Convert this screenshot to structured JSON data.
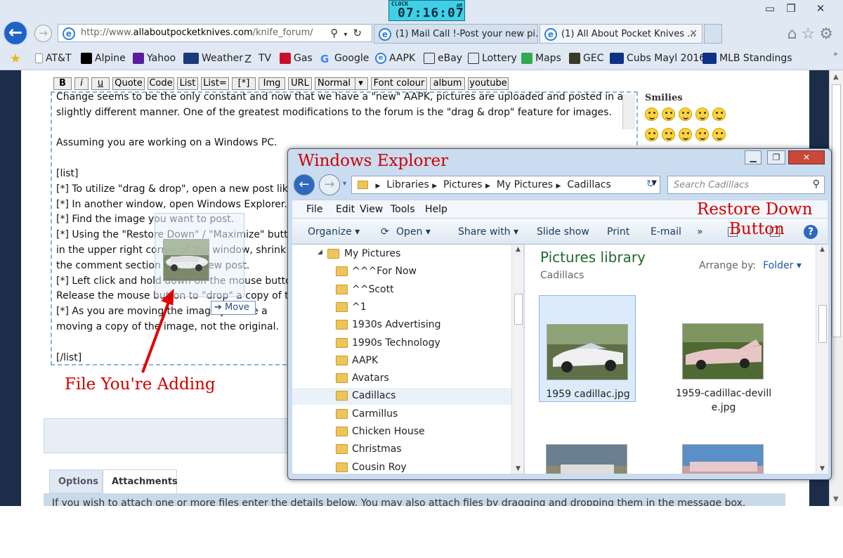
{
  "clock": {
    "label": "CLOCK",
    "time": "07:16:07",
    "ampm": "AM"
  },
  "window_controls": {
    "minimize": "▭",
    "restore": "❐",
    "close": "✕"
  },
  "address": {
    "url_prefix": "http://www.",
    "url_domain": "allaboutpocketknives.com",
    "url_path": "/knife_forum/pos"
  },
  "tabs": [
    {
      "label": "(1) Mail Call !-Post your new pi..."
    },
    {
      "label": "(1) All About Pocket Knives ..."
    }
  ],
  "favorites": [
    {
      "label": "AT&T",
      "color": "#ffffff"
    },
    {
      "label": "Alpine",
      "color": "#000000"
    },
    {
      "label": "Yahoo",
      "color": "#5b1c9c"
    },
    {
      "label": "Weather",
      "color": "#1a3a7a"
    },
    {
      "label": "TV",
      "color": "#ffffff"
    },
    {
      "label": "Gas",
      "color": "#c8102e"
    },
    {
      "label": "Google",
      "color": "#ffffff"
    },
    {
      "label": "AAPK",
      "color": "#ffffff"
    },
    {
      "label": "eBay",
      "color": "#ffffff"
    },
    {
      "label": "Lottery",
      "color": "#ffffff"
    },
    {
      "label": "Maps",
      "color": "#34a853"
    },
    {
      "label": "GEC",
      "color": "#3a3a2a"
    },
    {
      "label": "Cubs Mayl 2016",
      "color": "#0e3386"
    },
    {
      "label": "MLB Standings",
      "color": "#ffffff"
    }
  ],
  "editor_toolbar": [
    "B",
    "i",
    "u",
    "Quote",
    "Code",
    "List",
    "List=",
    "[*]",
    "Img",
    "URL",
    "Normal",
    "Font colour",
    "album",
    "youtube"
  ],
  "editor_lines": [
    "Change seems to be the only constant and now that we have a \"new\" AAPK, pictures are uploaded and posted in a",
    "slightly different manner. One of the greatest modifications to the forum is the \"drag & drop\" feature for images.",
    "",
    "Assuming you are working on a Windows PC.",
    "",
    "[list]",
    "[*] To utilize \"drag & drop\", open a new post lik",
    "[*] In another window, open Windows Explorer.",
    "[*] Find the image you want to post.",
    "[*] Using the \"Restore Down\" / \"Maximize\" butto",
    "in the upper right corner of the window, shrink",
    "the comment section of your new post.",
    "[*] Left click and hold down on the mouse butto",
    "Release the mouse button to \"drop\" a copy of th",
    "[*] As you are moving the image you see a",
    "moving a copy of the image, not the original.",
    "",
    "[/list]"
  ],
  "smilies": {
    "heading": "Smilies",
    "count": 12
  },
  "drag": {
    "tooltip": "Move"
  },
  "annotations": {
    "file_adding": "File You're Adding",
    "restore_down_1": "Restore Down",
    "restore_down_2": "Button"
  },
  "bottom_tabs": [
    "Options",
    "Attachments"
  ],
  "attach_text": "If you wish to attach one or more files enter the details below. You may also attach files by dragging and dropping them in the message box.",
  "explorer": {
    "caption": "Windows Explorer",
    "breadcrumb": [
      "Libraries",
      "Pictures",
      "My Pictures",
      "Cadillacs"
    ],
    "search_placeholder": "Search Cadillacs",
    "menu": [
      "File",
      "Edit",
      "View",
      "Tools",
      "Help"
    ],
    "commands": [
      "Organize ▾",
      "Open ▾",
      "Share with ▾",
      "Slide show",
      "Print",
      "E-mail",
      "»"
    ],
    "tree": [
      {
        "label": "My Pictures",
        "indent": 0
      },
      {
        "label": "^^^For Now",
        "indent": 1
      },
      {
        "label": "^^Scott",
        "indent": 1
      },
      {
        "label": "^1",
        "indent": 1
      },
      {
        "label": "1930s Advertising",
        "indent": 1
      },
      {
        "label": "1990s Technology",
        "indent": 1
      },
      {
        "label": "AAPK",
        "indent": 1
      },
      {
        "label": "Avatars",
        "indent": 1
      },
      {
        "label": "Cadillacs",
        "indent": 1,
        "selected": true
      },
      {
        "label": "Carmillus",
        "indent": 1
      },
      {
        "label": "Chicken House",
        "indent": 1
      },
      {
        "label": "Christmas",
        "indent": 1
      },
      {
        "label": "Cousin Roy",
        "indent": 1
      }
    ],
    "library_title": "Pictures library",
    "library_sub": "Cadillacs",
    "arrange_label": "Arrange by:",
    "arrange_value": "Folder ▾",
    "files": [
      {
        "name": "1959 cadillac.jpg",
        "selected": true
      },
      {
        "name": "1959-cadillac-devill e.jpg",
        "selected": false
      },
      {
        "name": "",
        "selected": false
      },
      {
        "name": "",
        "selected": false
      }
    ]
  }
}
